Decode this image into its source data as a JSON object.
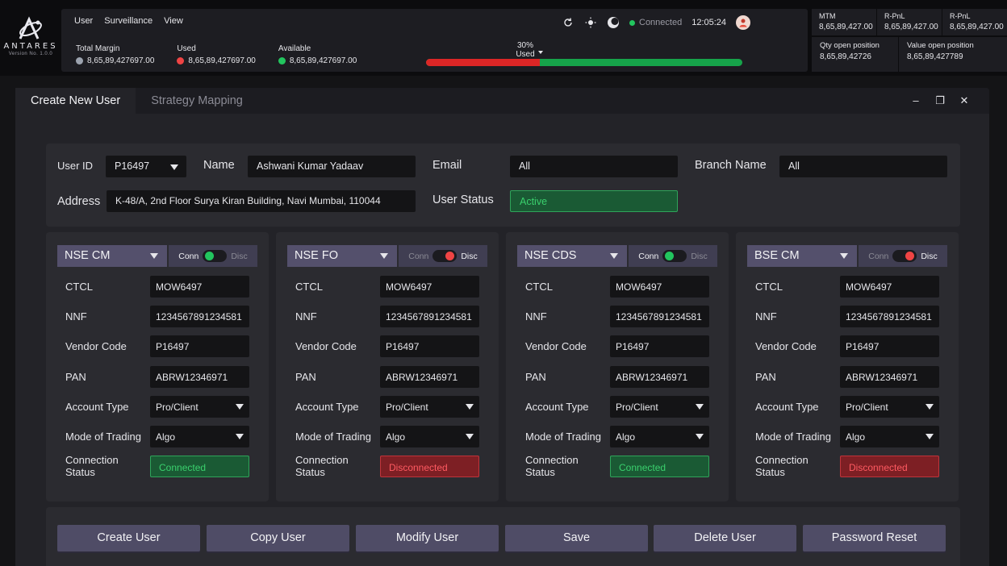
{
  "logo": {
    "brand": "ANTARES",
    "version": "Version No. 1.0.0"
  },
  "menu": {
    "items": [
      "User",
      "Surveillance",
      "View"
    ]
  },
  "status": {
    "connection": "Connected",
    "time": "12:05:24",
    "connection_color": "#22c55e"
  },
  "margins": {
    "total": {
      "label": "Total Margin",
      "value": "8,65,89,427697.00",
      "color": "#9ca3af"
    },
    "used": {
      "label": "Used",
      "value": "8,65,89,427697.00",
      "color": "#ef4444"
    },
    "available": {
      "label": "Available",
      "value": "8,65,89,427697.00",
      "color": "#22c55e"
    }
  },
  "usage": {
    "label": "30% Used",
    "percent": 36,
    "used_color": "#dc2626",
    "free_color": "#16a34a"
  },
  "stats": {
    "mtm": {
      "label": "MTM",
      "value": "8,65,89,427.00"
    },
    "rpnl1": {
      "label": "R-PnL",
      "value": "8,65,89,427.00"
    },
    "rpnl2": {
      "label": "R-PnL",
      "value": "8,65,89,427.00"
    },
    "qty_open": {
      "label": "Qty open position",
      "value": "8,65,89,42726"
    },
    "value_open": {
      "label": "Value open position",
      "value": "8,65,89,427789"
    }
  },
  "window": {
    "tabs": [
      "Create New User",
      "Strategy Mapping"
    ],
    "controls": {
      "minimize": "–",
      "maximize": "❐",
      "close": "✕"
    }
  },
  "user": {
    "user_id_label": "User ID",
    "user_id": "P16497",
    "name_label": "Name",
    "name": "Ashwani Kumar Yadaav",
    "email_label": "Email",
    "email": "All",
    "branch_label": "Branch Name",
    "branch": "All",
    "address_label": "Address",
    "address": "K-48/A, 2nd Floor Surya Kiran Building, Navi Mumbai, 110044",
    "status_label": "User Status",
    "status": "Active"
  },
  "card_labels": {
    "ctcl": "CTCL",
    "nnf": "NNF",
    "vendor": "Vendor Code",
    "pan": "PAN",
    "account": "Account Type",
    "mode": "Mode of Trading",
    "conn_line1": "Connection",
    "conn_line2": "Status",
    "conn_toggle_on": "Conn",
    "conn_toggle_off": "Disc"
  },
  "exchanges": [
    {
      "name": "NSE CM",
      "connected": true,
      "ctcl": "MOW6497",
      "nnf": "1234567891234581",
      "vendor": "P16497",
      "pan": "ABRW12346971",
      "account": "Pro/Client",
      "mode": "Algo",
      "status": "Connected"
    },
    {
      "name": "NSE FO",
      "connected": false,
      "ctcl": "MOW6497",
      "nnf": "1234567891234581",
      "vendor": "P16497",
      "pan": "ABRW12346971",
      "account": "Pro/Client",
      "mode": "Algo",
      "status": "Disconnected"
    },
    {
      "name": "NSE CDS",
      "connected": true,
      "ctcl": "MOW6497",
      "nnf": "1234567891234581",
      "vendor": "P16497",
      "pan": "ABRW12346971",
      "account": "Pro/Client",
      "mode": "Algo",
      "status": "Connected"
    },
    {
      "name": "BSE CM",
      "connected": false,
      "ctcl": "MOW6497",
      "nnf": "1234567891234581",
      "vendor": "P16497",
      "pan": "ABRW12346971",
      "account": "Pro/Client",
      "mode": "Algo",
      "status": "Disconnected"
    }
  ],
  "actions": [
    "Create User",
    "Copy User",
    "Modify User",
    "Save",
    "Delete User",
    "Password Reset"
  ]
}
